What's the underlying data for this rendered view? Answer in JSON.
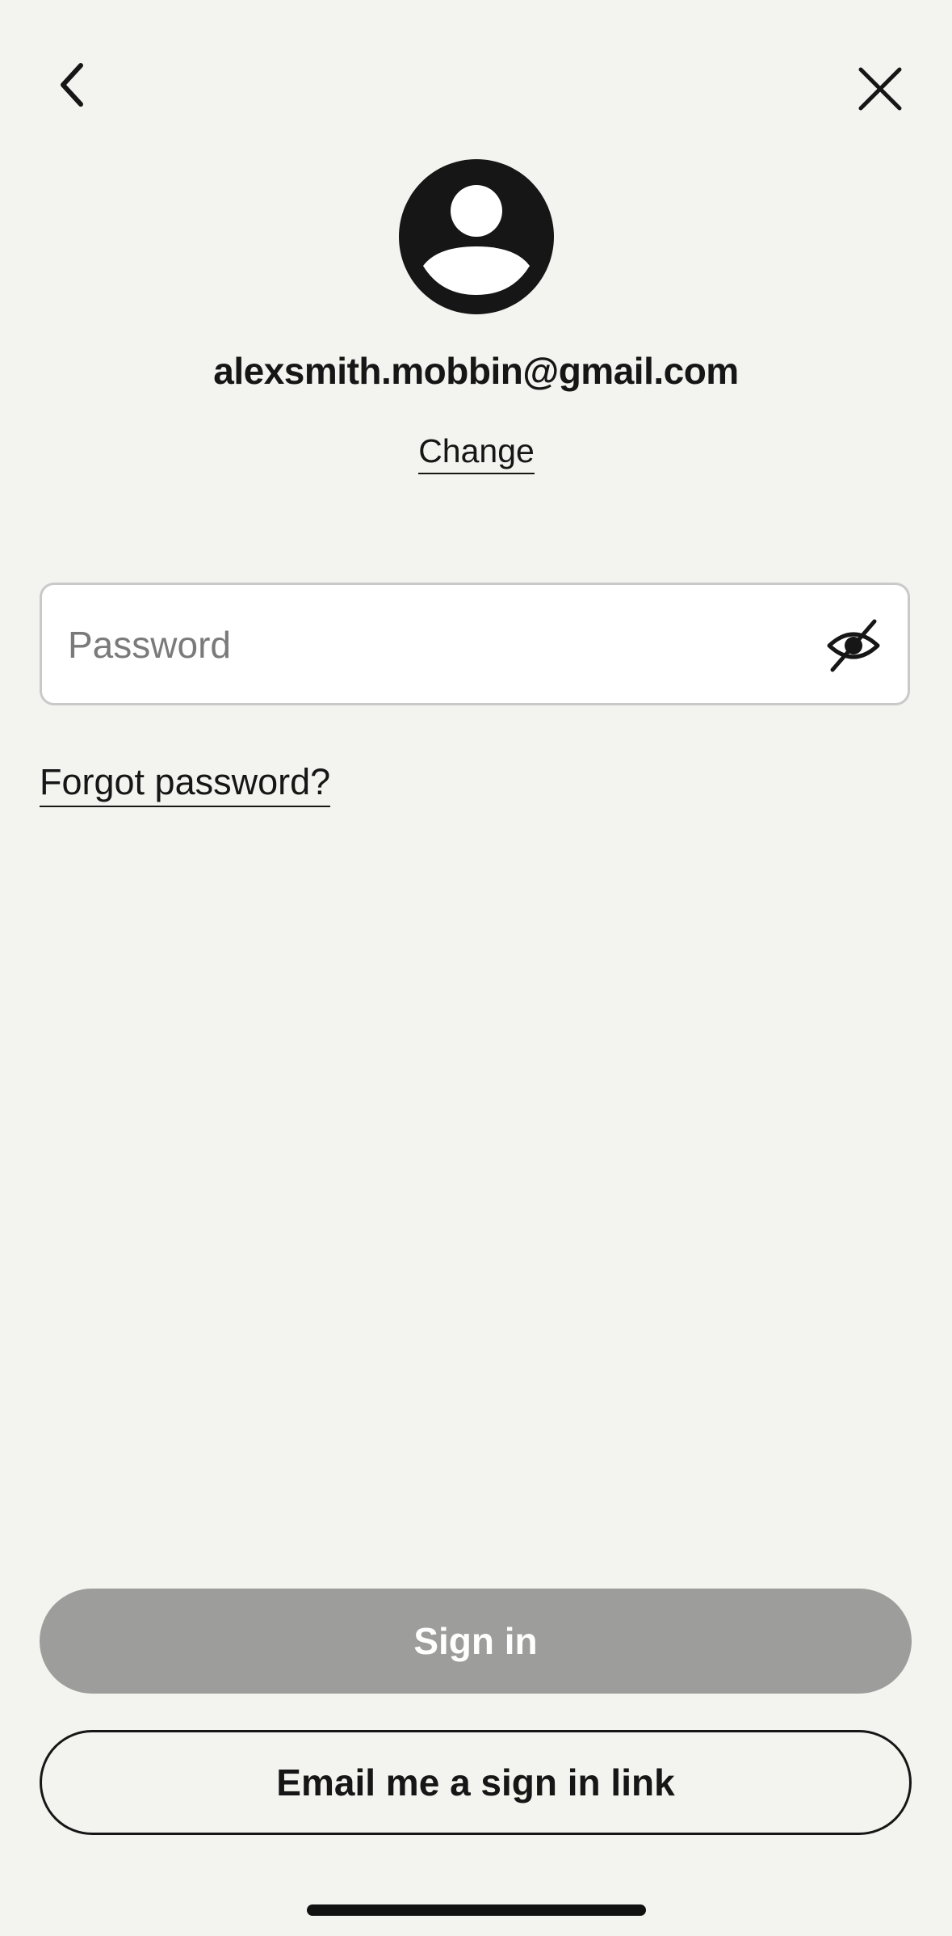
{
  "header": {
    "back_icon": "chevron-left-icon",
    "close_icon": "close-icon"
  },
  "account": {
    "avatar_icon": "user-avatar-icon",
    "email": "alexsmith.mobbin@gmail.com",
    "change_label": "Change"
  },
  "password": {
    "placeholder": "Password",
    "value": "",
    "toggle_icon": "eye-slash-icon"
  },
  "forgot_label": "Forgot password?",
  "actions": {
    "sign_in_label": "Sign in",
    "email_link_label": "Email me a sign in link"
  },
  "colors": {
    "background": "#f3f3ef",
    "text": "#161616",
    "disabled_button": "#9d9d9b",
    "field_border": "#c9c9c9"
  }
}
